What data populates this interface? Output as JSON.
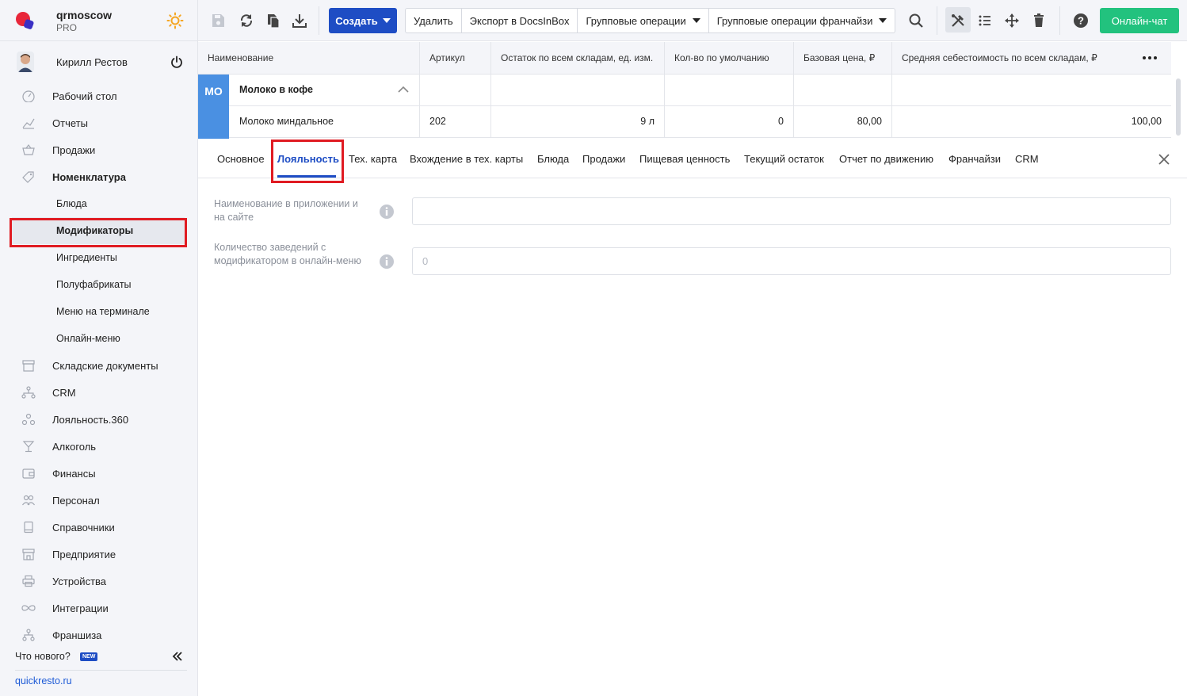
{
  "brand": {
    "name": "qrmoscow",
    "plan": "PRO"
  },
  "user": {
    "name": "Кирилл Рестов"
  },
  "nav": {
    "items": [
      {
        "label": "Рабочий стол",
        "icon": "dashboard-icon"
      },
      {
        "label": "Отчеты",
        "icon": "chart-icon"
      },
      {
        "label": "Продажи",
        "icon": "basket-icon"
      },
      {
        "label": "Номенклатура",
        "icon": "tag-icon"
      }
    ],
    "sub": [
      {
        "label": "Блюда"
      },
      {
        "label": "Модификаторы"
      },
      {
        "label": "Ингредиенты"
      },
      {
        "label": "Полуфабрикаты"
      },
      {
        "label": "Меню на терминале"
      },
      {
        "label": "Онлайн-меню"
      }
    ],
    "rest": [
      {
        "label": "Складские документы",
        "icon": "box-icon"
      },
      {
        "label": "CRM",
        "icon": "network-icon"
      },
      {
        "label": "Лояльность.360",
        "icon": "loyalty-icon"
      },
      {
        "label": "Алкоголь",
        "icon": "glass-icon"
      },
      {
        "label": "Финансы",
        "icon": "wallet-icon"
      },
      {
        "label": "Персонал",
        "icon": "people-icon"
      },
      {
        "label": "Справочники",
        "icon": "book-icon"
      },
      {
        "label": "Предприятие",
        "icon": "store-icon"
      },
      {
        "label": "Устройства",
        "icon": "printer-icon"
      },
      {
        "label": "Интеграции",
        "icon": "infinity-icon"
      },
      {
        "label": "Франшиза",
        "icon": "franchise-icon"
      }
    ]
  },
  "footer": {
    "whats_new": "Что нового?",
    "badge": "NEW",
    "site": "quickresto.ru"
  },
  "toolbar": {
    "create_label": "Создать",
    "delete_label": "Удалить",
    "export_label": "Экспорт в DocsInBox",
    "group_ops_label": "Групповые операции",
    "franchise_ops_label": "Групповые операции франчайзи",
    "chat_label": "Онлайн-чат"
  },
  "table": {
    "columns": [
      "Наименование",
      "Артикул",
      "Остаток по всем складам, ед. изм.",
      "Кол-во по умолчанию",
      "Базовая цена, ₽",
      "Средняя себестоимость по всем складам, ₽"
    ],
    "group": {
      "mark": "МО",
      "name": "Молоко в кофе"
    },
    "rows": [
      {
        "name": "Молоко миндальное",
        "sku": "202",
        "stock": "9 л",
        "default_qty": "0",
        "price": "80,00",
        "cost": "100,00"
      }
    ]
  },
  "tabs": [
    "Основное",
    "Лояльность",
    "Тех. карта",
    "Вхождение в тех. карты",
    "Блюда",
    "Продажи",
    "Пищевая ценность",
    "Текущий остаток",
    "Отчет по движению",
    "Франчайзи",
    "CRM"
  ],
  "form": {
    "field1": {
      "label": "Наименование в приложении и на сайте",
      "value": ""
    },
    "field2": {
      "label": "Количество заведений с модификатором в онлайн-меню",
      "placeholder": "0"
    }
  },
  "colors": {
    "accent": "#1e4dc4",
    "chat": "#22c27e",
    "group": "#4a90e2",
    "highlight": "#e01b22"
  }
}
